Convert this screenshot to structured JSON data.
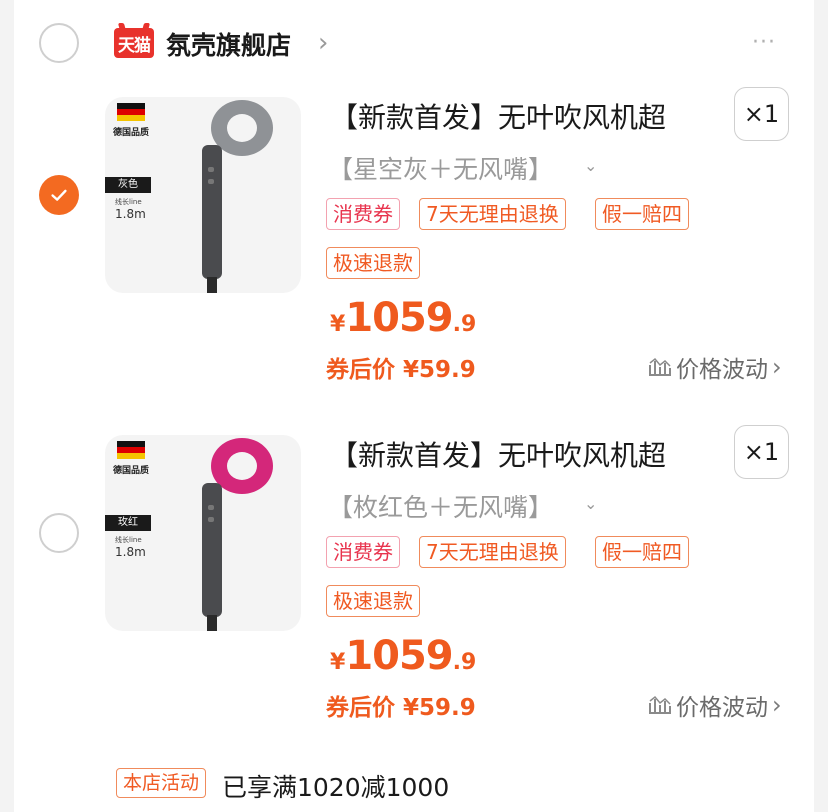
{
  "shop": {
    "logo_text": "天猫",
    "name": "氛壳旗舰店",
    "more": "···"
  },
  "products": [
    {
      "selected": true,
      "image": {
        "origin_label": "德国品质",
        "color_tag": "灰色",
        "cable_label": "线长line",
        "cable_length": "1.8m",
        "dryer_color": "#8f9296"
      },
      "title": "【新款首发】无叶吹风机超",
      "quantity": "×1",
      "sku": "【星空灰＋无风嘴】",
      "tags": [
        "消费券",
        "7天无理由退换",
        "假一赔四",
        "极速退款"
      ],
      "price": {
        "currency": "¥",
        "integer": "1059",
        "decimal": ".9"
      },
      "coupon_price": "券后价 ¥59.9",
      "trend_label": "价格波动"
    },
    {
      "selected": false,
      "image": {
        "origin_label": "德国品质",
        "color_tag": "玫红",
        "cable_label": "线长line",
        "cable_length": "1.8m",
        "dryer_color": "#d4277a"
      },
      "title": "【新款首发】无叶吹风机超",
      "quantity": "×1",
      "sku": "【枚红色＋无风嘴】",
      "tags": [
        "消费券",
        "7天无理由退换",
        "假一赔四",
        "极速退款"
      ],
      "price": {
        "currency": "¥",
        "integer": "1059",
        "decimal": ".9"
      },
      "coupon_price": "券后价 ¥59.9",
      "trend_label": "价格波动"
    }
  ],
  "promo": {
    "badge": "本店活动",
    "text": "已享满1020减1000"
  },
  "colors": {
    "accent": "#f36a21",
    "price": "#ef5a1e",
    "tmall_red": "#e8322c"
  }
}
